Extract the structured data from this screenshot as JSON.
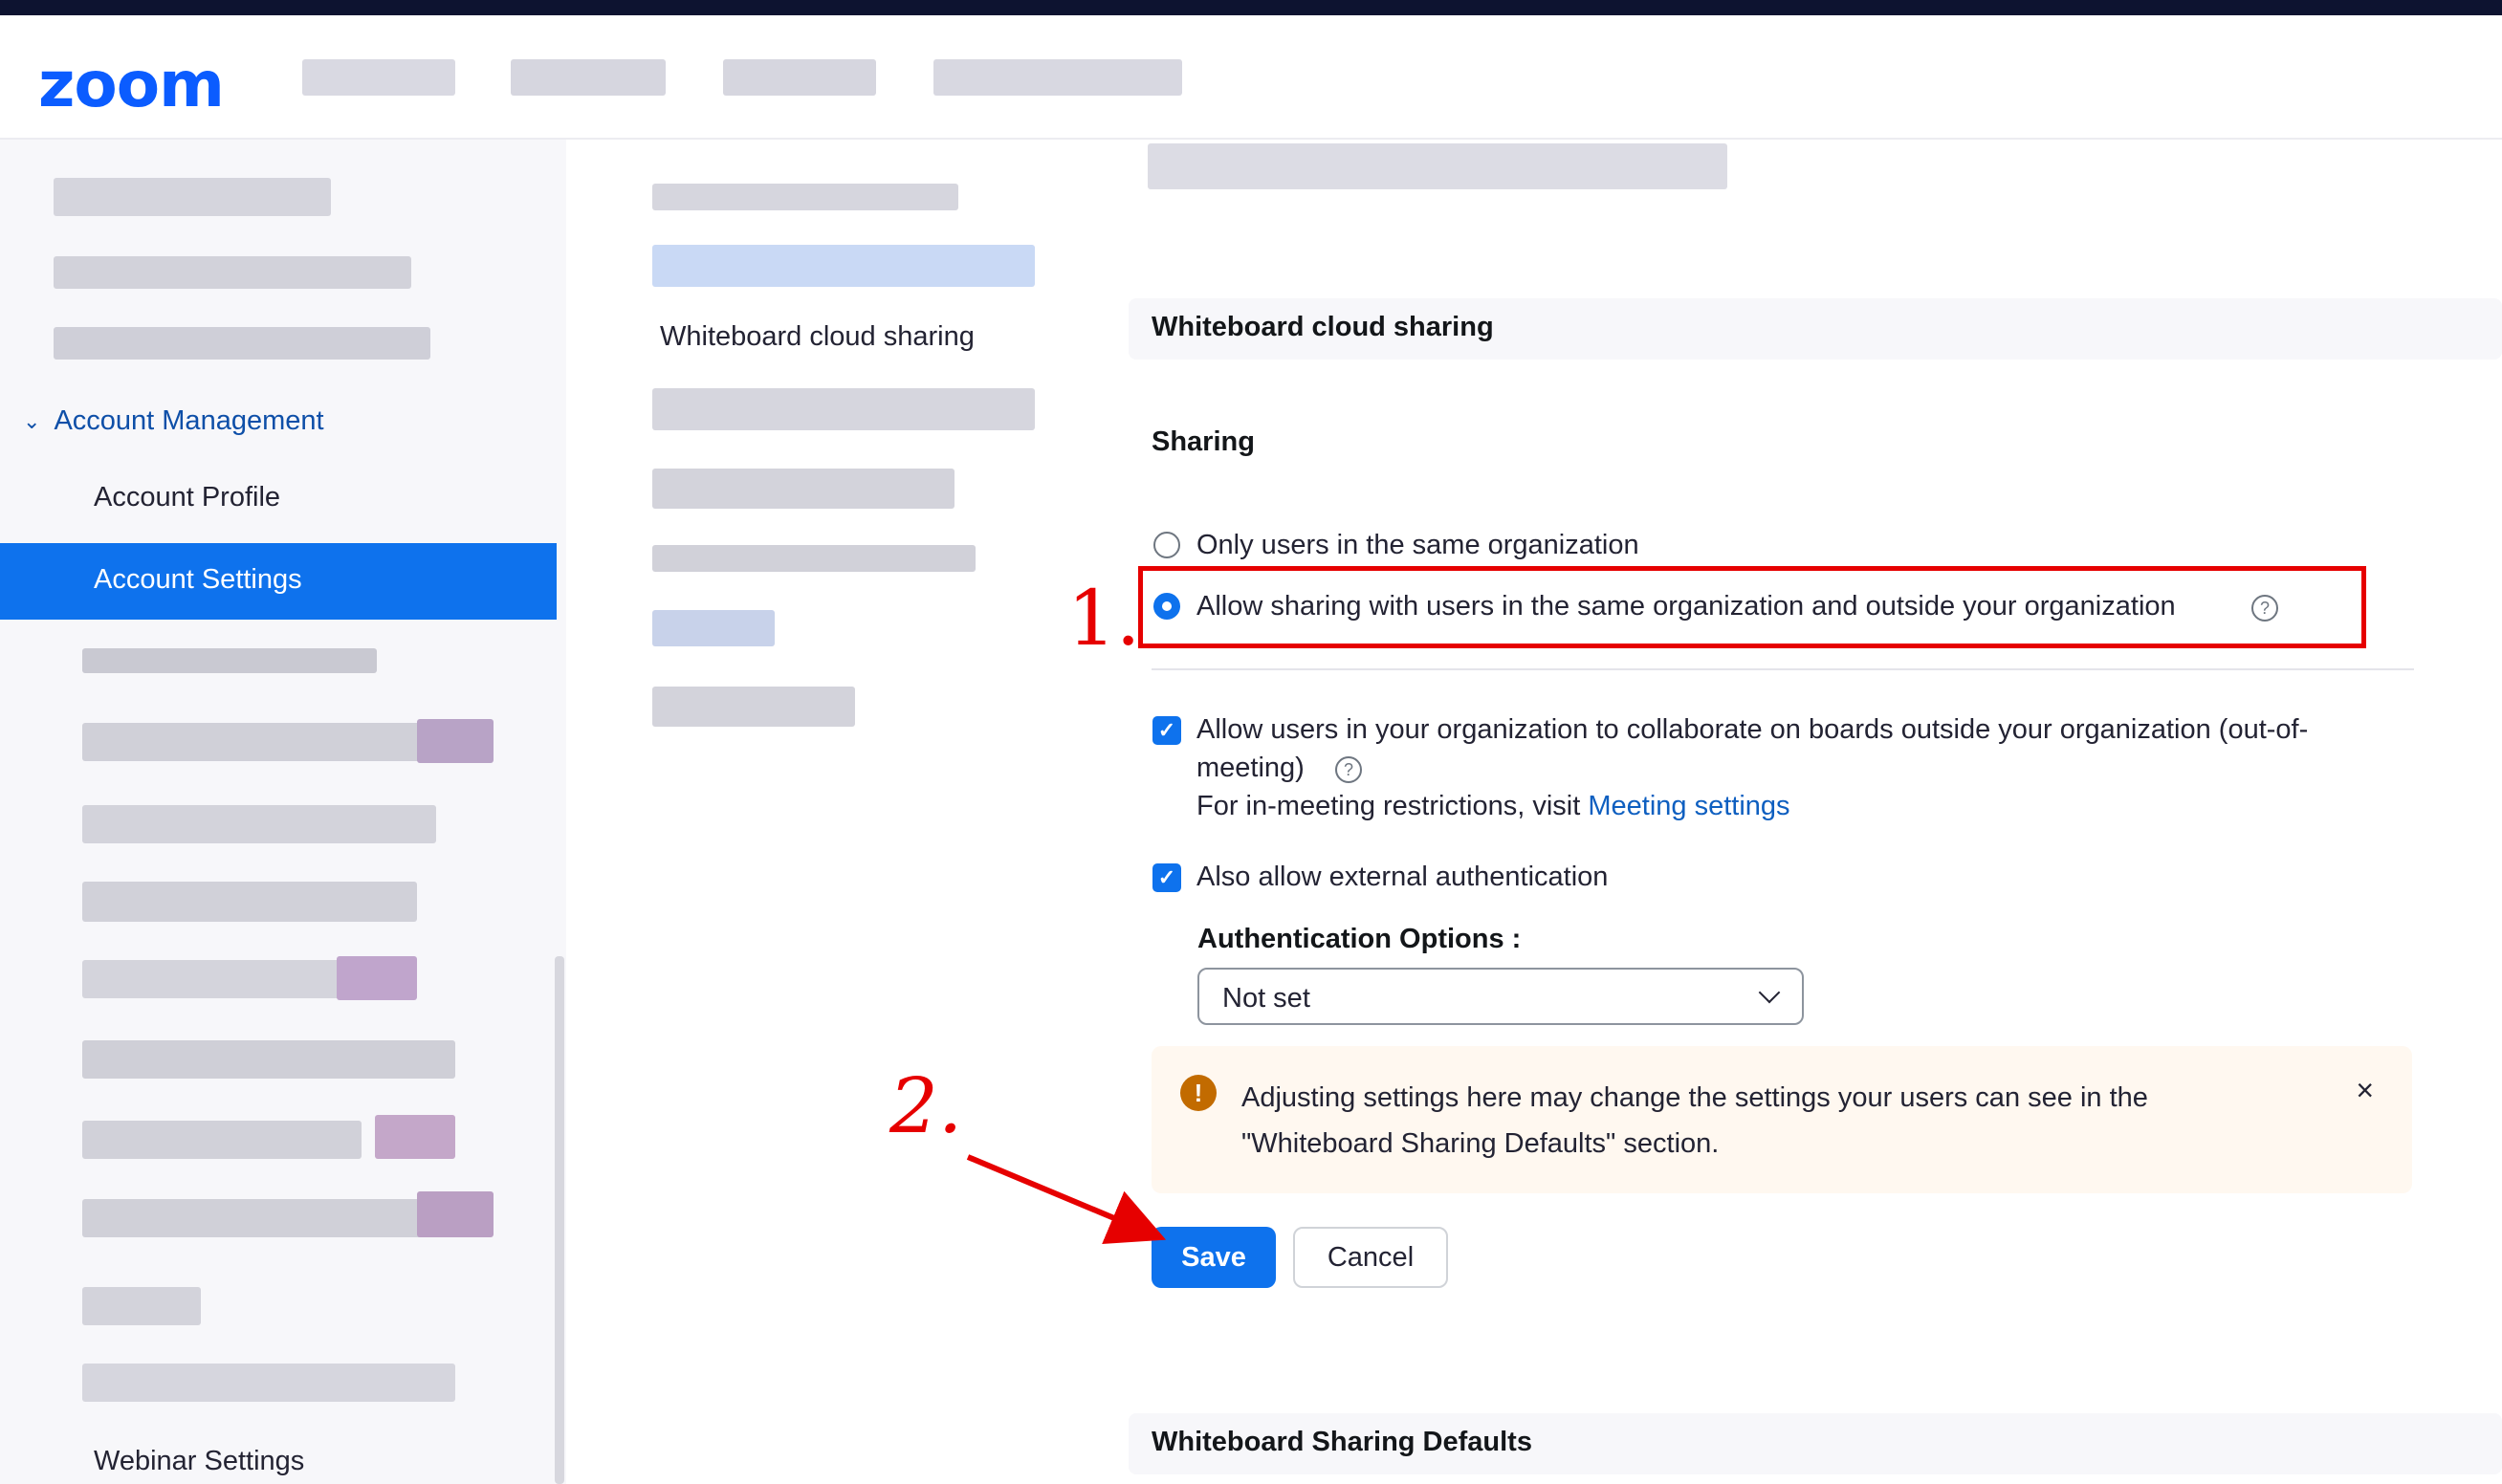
{
  "header": {
    "logo_text": "zoom"
  },
  "sidebar": {
    "section_label": "Account Management",
    "items": [
      {
        "label": "Account Profile"
      },
      {
        "label": "Account Settings",
        "active": true
      },
      {
        "label": "Webinar Settings"
      }
    ]
  },
  "middle_nav": {
    "active_link": "Whiteboard cloud sharing"
  },
  "main": {
    "section_title": "Whiteboard cloud sharing",
    "subsection_title": "Sharing",
    "radio_options": [
      {
        "label": "Only users in the same organization",
        "selected": false
      },
      {
        "label": "Allow sharing with users in the same organization and outside your organization",
        "selected": true
      }
    ],
    "collab_checkbox": {
      "checked": true,
      "label_line1": "Allow users in your organization to collaborate on boards outside your organization (out-of-",
      "label_line2": "meeting)",
      "restriction_text": "For in-meeting restrictions, visit",
      "restriction_link": "Meeting settings"
    },
    "external_auth_checkbox": {
      "checked": true,
      "label": "Also allow external authentication"
    },
    "auth_options_label": "Authentication Options :",
    "auth_select_value": "Not set",
    "notice": {
      "line1": "Adjusting settings here may change the settings your users can see in the",
      "line2": "\"Whiteboard Sharing Defaults\" section."
    },
    "save_label": "Save",
    "cancel_label": "Cancel",
    "next_section_title": "Whiteboard Sharing Defaults"
  },
  "annotations": {
    "step1": "1.",
    "step2": "2.",
    "color": "#e60000"
  },
  "colors": {
    "accent": "#0e72ed",
    "brand": "#0b5cff",
    "link": "#0e5fc0",
    "warning": "#c26b00"
  }
}
